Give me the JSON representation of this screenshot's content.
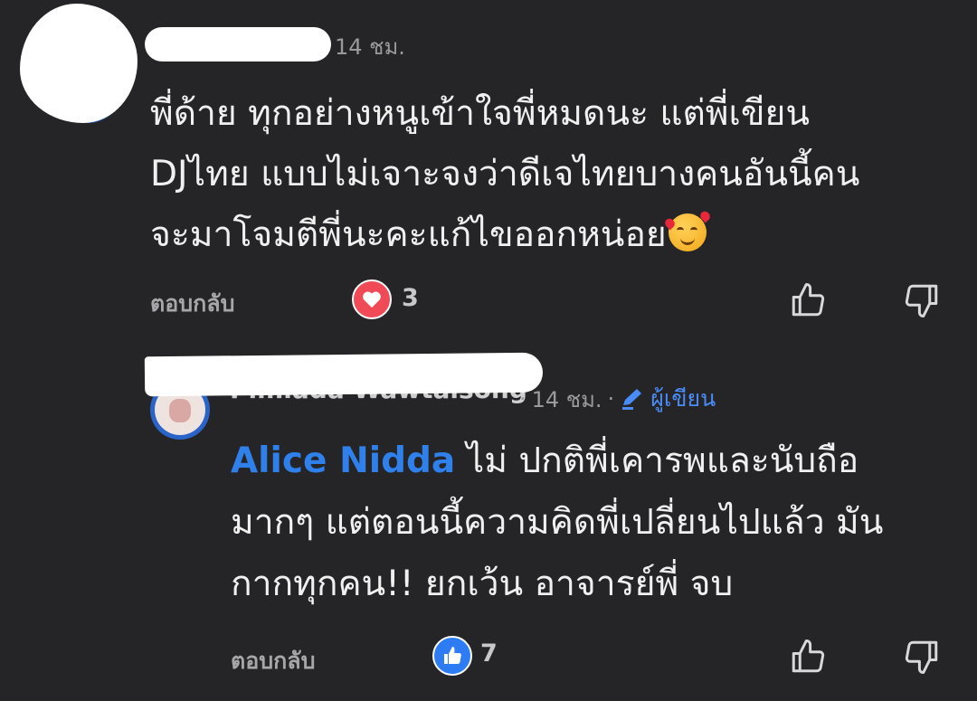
{
  "comment1": {
    "time": "14 ชม.",
    "text_lines": [
      "พี่ด้าย ทุกอย่างหนูเข้าใจพี่หมดนะ แต่พี่เขียน",
      "DJไทย แบบไม่เจาะจงว่าดีเจไทยบางคนอันนี้คน",
      "จะมาโจมตีพี่นะคะแก้ไขออกหน่อย"
    ],
    "emoji": "smiling-face-with-hearts",
    "reply_label": "ตอบกลับ",
    "reaction_type": "love",
    "reaction_count": "3",
    "reaction_color": "#ef4a55"
  },
  "comment2": {
    "author_name_partial": "Pimlada Wawtaisong",
    "time": "14 ชม.",
    "separator": "·",
    "author_badge": "ผู้เขียน",
    "mention": "Alice Nidda",
    "text_first": " ไม่ ปกติพี่เคารพและนับถือ",
    "text_lines": [
      "มากๆ แต่ตอนนี้ความคิดพี่เปลี่ยนไปแล้ว มัน",
      "กากทุกคน!! ยกเว้น อาจารย์พี่ จบ"
    ],
    "reply_label": "ตอบกลับ",
    "reaction_type": "like",
    "reaction_count": "7",
    "reaction_color": "#2d7cf4",
    "mention_color": "#2f80ea"
  },
  "theme": {
    "background": "#252527",
    "text": "#f0f0f0",
    "muted": "#9a9a9e"
  }
}
